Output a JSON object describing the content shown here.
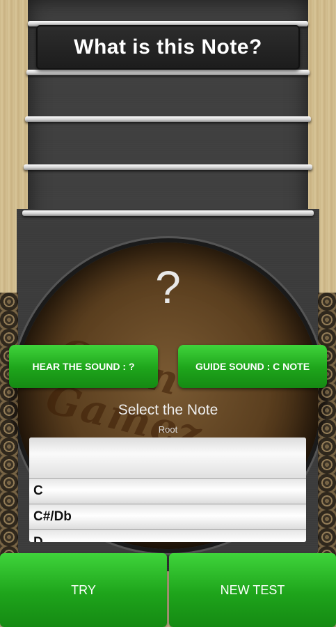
{
  "header": {
    "title": "What is this Note?"
  },
  "note_display": {
    "symbol": "?"
  },
  "background": {
    "watermark": "Open Gamez"
  },
  "buttons": {
    "hear_sound": "HEAR THE SOUND : ?",
    "guide_sound": "GUIDE SOUND : C NOTE",
    "try": "TRY",
    "new_test": "NEW TEST"
  },
  "picker": {
    "title": "Select the Note",
    "subtitle": "Root",
    "options": [
      "C",
      "C#/Db",
      "D"
    ]
  },
  "colors": {
    "accent_green": "#1ea41b",
    "fret_white": "#ffffff",
    "neck_dark": "#3a3a3a"
  }
}
